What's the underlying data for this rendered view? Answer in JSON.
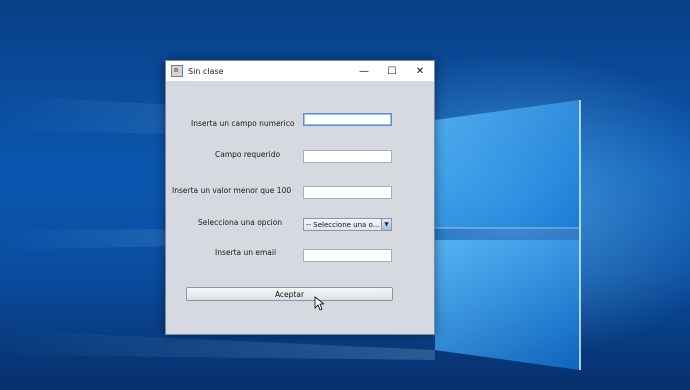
{
  "window": {
    "title": "Sin clase",
    "minimize_glyph": "—",
    "maximize_glyph": "☐",
    "close_glyph": "✕"
  },
  "form": {
    "fields": [
      {
        "label": "Inserta un campo numerico",
        "value": ""
      },
      {
        "label": "Campo requerido",
        "value": ""
      },
      {
        "label": "Inserta un valor menor que 100",
        "value": ""
      },
      {
        "label": "Selecciona una opcion",
        "selected": "-- Seleccione una o..."
      },
      {
        "label": "Inserta un email",
        "value": ""
      }
    ],
    "submit_label": "Aceptar"
  },
  "icons": {
    "app": "java-coffee-icon",
    "combo_arrow": "chevron-down-icon",
    "cursor": "mouse-pointer-icon"
  },
  "colors": {
    "window_bg": "#d6d9df",
    "desktop_blue": "#0b57b0"
  }
}
